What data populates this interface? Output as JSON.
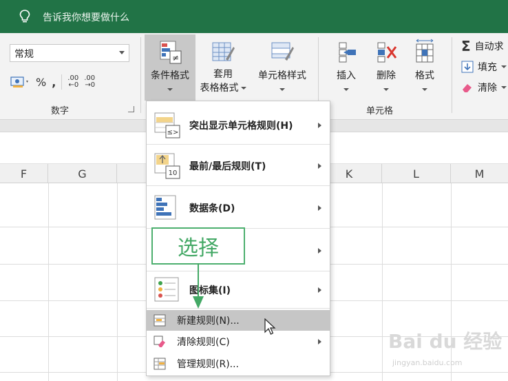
{
  "tellme": {
    "text": "告诉我你想要做什么"
  },
  "ribbon": {
    "number_format": "常规",
    "number_tools": {
      "percent": "%",
      "comma": ",",
      "inc_decimal": ".00",
      "dec_decimal": ".00"
    },
    "number_group_label": "数字",
    "buttons": {
      "conditional_formatting": {
        "label": "条件格式"
      },
      "format_as_table": {
        "label_line1": "套用",
        "label_line2": "表格格式"
      },
      "cell_styles": {
        "label": "单元格样式"
      },
      "insert": {
        "label": "插入"
      },
      "delete": {
        "label": "删除"
      },
      "format": {
        "label": "格式"
      }
    },
    "cells_group_label": "单元格",
    "editing": {
      "autosum": "自动求",
      "fill": "填充",
      "clear": "清除"
    }
  },
  "columns": [
    "F",
    "G",
    "K",
    "L",
    "M"
  ],
  "menu": {
    "items": [
      {
        "label": "突出显示单元格规则(H)"
      },
      {
        "label": "最前/最后规则(T)"
      },
      {
        "label": "数据条(D)"
      },
      {
        "label": ""
      },
      {
        "label": "图标集(I)"
      }
    ],
    "small_items": [
      {
        "label": "新建规则(N)..."
      },
      {
        "label": "清除规则(C)"
      },
      {
        "label": "管理规则(R)..."
      }
    ]
  },
  "annotation": {
    "text": "选择"
  },
  "watermark": {
    "brand": "Bai du 经验",
    "url": "jingyan.baidu.com"
  },
  "colors": {
    "excel_green": "#217346",
    "annotation_green": "#43a865",
    "menu_hover": "#c6c6c6"
  }
}
